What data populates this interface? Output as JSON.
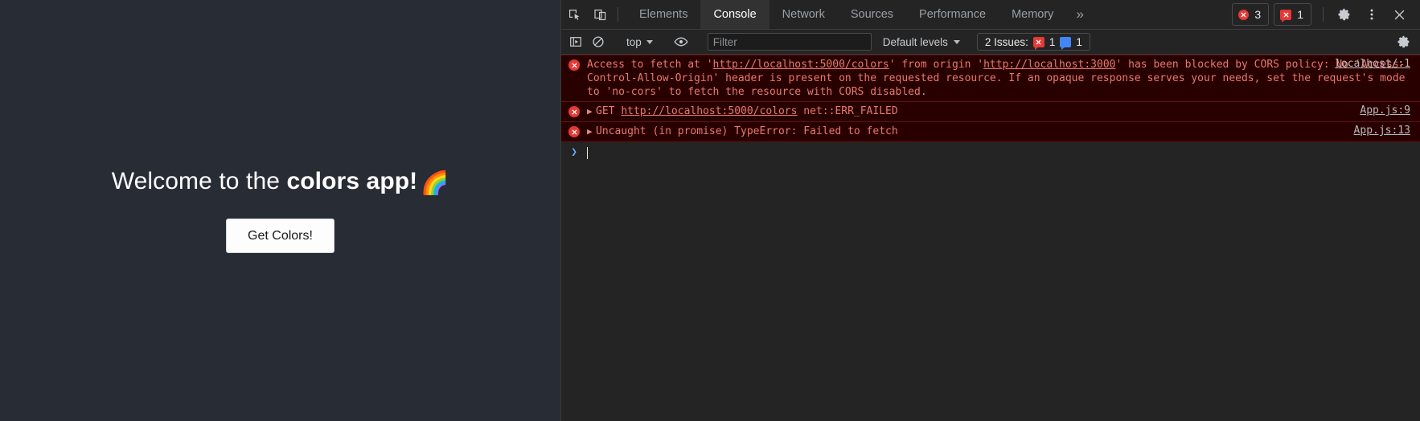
{
  "page": {
    "welcome_prefix": "Welcome to the ",
    "welcome_bold": "colors app!",
    "rainbow_emoji": "🌈",
    "get_colors_button": "Get Colors!"
  },
  "devtools": {
    "tabs": [
      {
        "label": "Elements",
        "active": false
      },
      {
        "label": "Console",
        "active": true
      },
      {
        "label": "Network",
        "active": false
      },
      {
        "label": "Sources",
        "active": false
      },
      {
        "label": "Performance",
        "active": false
      },
      {
        "label": "Memory",
        "active": false
      }
    ],
    "more_tabs_glyph": "»",
    "error_badge_count": "3",
    "issue_badge_count": "1",
    "inspect_icon": "inspect-element-icon",
    "device_icon": "device-toolbar-icon",
    "settings_icon": "gear-icon",
    "kebab_icon": "more-options-icon",
    "close_icon": "close-icon",
    "console_bar": {
      "sidebar_toggle_icon": "console-sidebar-icon",
      "clear_icon": "clear-console-icon",
      "context_value": "top",
      "eye_icon": "live-expression-icon",
      "filter_placeholder": "Filter",
      "filter_value": "",
      "levels_value": "Default levels",
      "issues_label": "2 Issues:",
      "issues_error_count": "1",
      "issues_info_count": "1",
      "settings_icon": "gear-icon"
    },
    "console_messages": [
      {
        "type": "error",
        "expandable": false,
        "segments": [
          {
            "text": "Access to fetch at '",
            "link": false
          },
          {
            "text": "http://localhost:5000/colors",
            "link": true
          },
          {
            "text": "' from origin '",
            "link": false
          },
          {
            "text": "http://localhost:3000",
            "link": true
          },
          {
            "text": "' has been blocked by CORS policy: No 'Access-Control-Allow-Origin' header is present on the requested resource. If an opaque response serves your needs, set the request's mode to 'no-cors' to fetch the resource with CORS disabled.",
            "link": false
          }
        ],
        "source": "localhost/:1"
      },
      {
        "type": "error",
        "expandable": true,
        "segments": [
          {
            "text": "GET ",
            "link": false
          },
          {
            "text": "http://localhost:5000/colors",
            "link": true
          },
          {
            "text": " net::ERR_FAILED",
            "link": false
          }
        ],
        "source": "App.js:9"
      },
      {
        "type": "error",
        "expandable": true,
        "segments": [
          {
            "text": "Uncaught (in promise) TypeError: Failed to fetch",
            "link": false
          }
        ],
        "source": "App.js:13"
      }
    ],
    "prompt_glyph": "❯"
  },
  "colors": {
    "page_bg": "#282c34",
    "devtools_bg": "#242424",
    "error_row_bg": "#290000",
    "error_text": "#e8796f",
    "error_red": "#e53935",
    "issue_blue": "#4285f4",
    "tab_active_bg": "#323232"
  }
}
